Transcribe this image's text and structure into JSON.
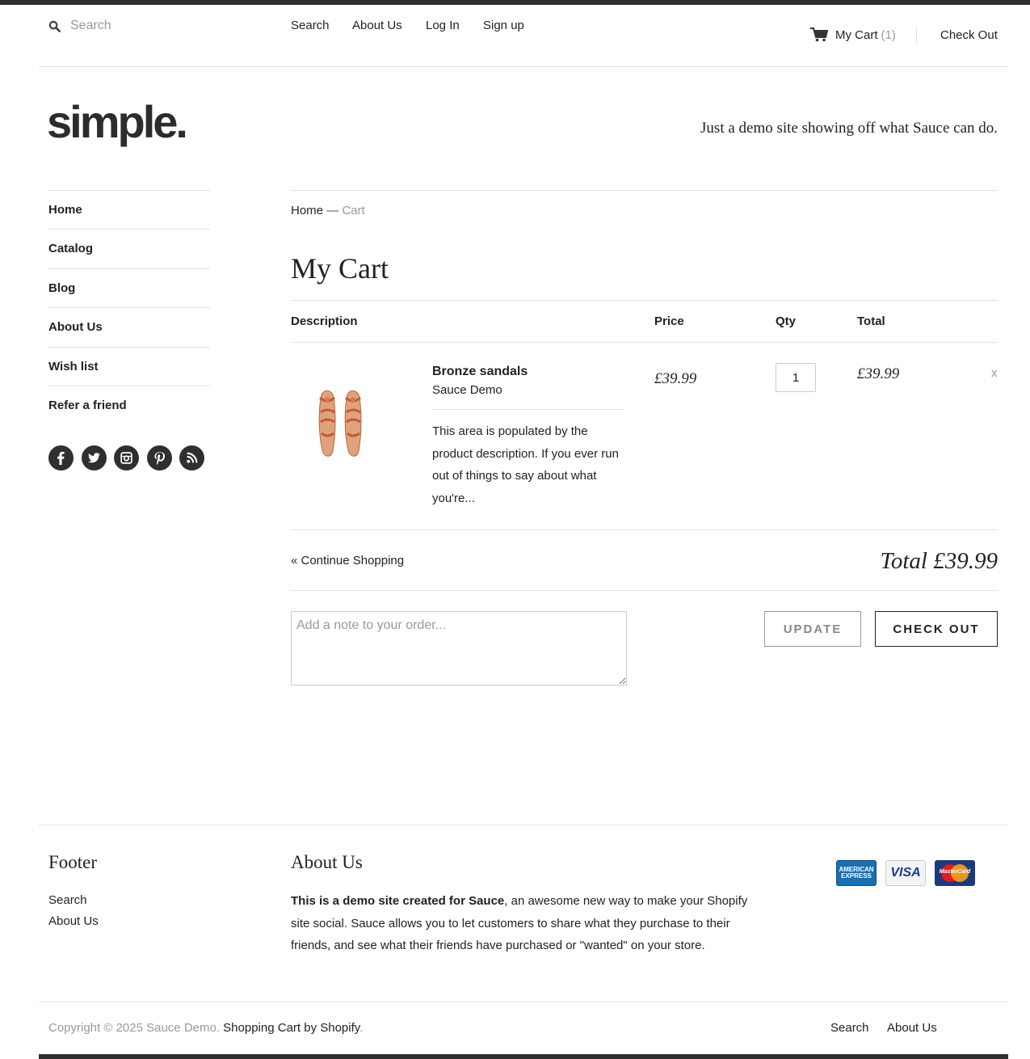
{
  "header": {
    "search_placeholder": "Search",
    "nav": [
      "Search",
      "About Us",
      "Log In",
      "Sign up"
    ],
    "cart_label": "My Cart",
    "cart_count": "(1)",
    "checkout_label": "Check Out"
  },
  "brand": {
    "logo": "simple.",
    "tagline": "Just a demo site showing off what Sauce can do."
  },
  "sidebar": {
    "items": [
      "Home",
      "Catalog",
      "Blog",
      "About Us",
      "Wish list",
      "Refer a friend"
    ],
    "social_icons": [
      "facebook-icon",
      "twitter-icon",
      "instagram-icon",
      "pinterest-icon",
      "rss-icon"
    ]
  },
  "breadcrumb": {
    "home": "Home",
    "separator": "—",
    "current": "Cart"
  },
  "cart": {
    "title": "My Cart",
    "columns": [
      "Description",
      "Price",
      "Qty",
      "Total"
    ],
    "items": [
      {
        "name": "Bronze sandals",
        "vendor": "Sauce Demo",
        "description": "This area is populated by the product description. If you ever run out of things to say about what you're...",
        "price": "£39.99",
        "qty": "1",
        "total": "£39.99",
        "remove": "x"
      }
    ],
    "continue_label": "« Continue Shopping",
    "grand_total": "Total £39.99",
    "note_placeholder": "Add a note to your order...",
    "update_label": "UPDATE",
    "checkout_label": "CHECK OUT"
  },
  "footer": {
    "col1_title": "Footer",
    "col1_links": [
      "Search",
      "About Us"
    ],
    "col2_title": "About Us",
    "about_bold": "This is a demo site created for",
    "about_link": "Sauce",
    "about_rest": ", an awesome new way to make your Shopify site social. Sauce allows you to let customers to share what they purchase to their friends, and see what their friends have purchased or \"wanted\" on your store.",
    "cards": [
      "AMERICAN EXPRESS",
      "VISA",
      "MasterCard"
    ],
    "copyright": "Copyright © 2025 Sauce Demo.",
    "powered": "Shopping Cart by Shopify",
    "bottom_links": [
      "Search",
      "About Us"
    ]
  }
}
